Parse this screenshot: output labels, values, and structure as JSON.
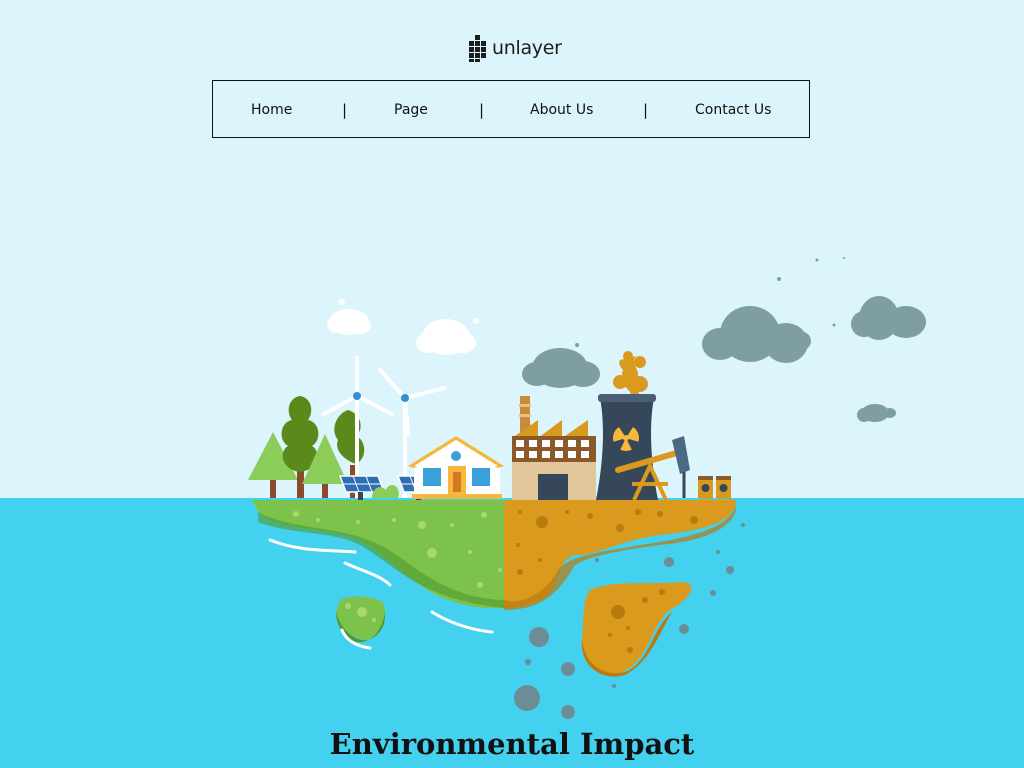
{
  "brand": {
    "name": "unlayer",
    "logo_icon": "unlayer-logo-icon"
  },
  "nav": {
    "items": [
      {
        "label": "Home"
      },
      {
        "label": "Page"
      },
      {
        "label": "About Us"
      },
      {
        "label": "Contact Us"
      }
    ],
    "separator": "|"
  },
  "hero": {
    "illustration": "island-environment-illustration",
    "headline": "Environmental Impact"
  },
  "colors": {
    "sky": "#dcf4fb",
    "sea": "#44d1f0",
    "grass": "#7dc24b",
    "soil": "#d99a1e",
    "smoke": "#7e9e9f",
    "tower": "#37475a"
  }
}
